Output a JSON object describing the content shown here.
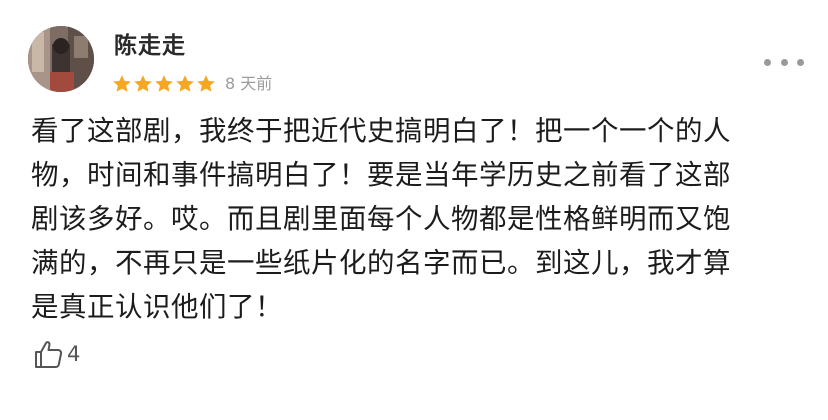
{
  "review": {
    "username": "陈走走",
    "rating": 5,
    "rating_max": 5,
    "time_ago": "8 天前",
    "text": "看了这部剧，我终于把近代史搞明白了！把一个一个的人\n物，时间和事件搞明白了！要是当年学历史之前看了这部\n剧该多好。哎。而且剧里面每个人物都是性格鲜明而又饱\n满的，不再只是一些纸片化的名字而已。到这儿，我才算\n是真正认识他们了！",
    "like_count": "4"
  },
  "colors": {
    "star": "#f5a623",
    "timestamp": "#9c9c9c",
    "text": "#1c1c1c",
    "more_dots": "#9a9a9a"
  },
  "icons": {
    "more": "more-dots-icon",
    "like": "thumbs-up-icon",
    "star": "star-icon"
  }
}
